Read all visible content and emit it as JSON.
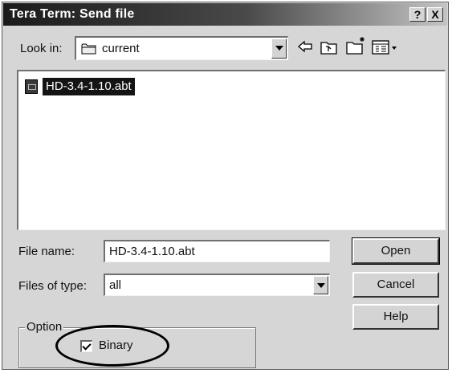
{
  "window": {
    "title": "Tera Term: Send file",
    "help_button": "?",
    "close_button": "X"
  },
  "look_in": {
    "label": "Look in:",
    "value": "current"
  },
  "toolbar": {
    "icons": [
      "back-arrow-icon",
      "up-one-level-icon",
      "new-folder-icon",
      "view-menu-icon"
    ]
  },
  "files": [
    {
      "name": "HD-3.4-1.10.abt",
      "selected": true
    }
  ],
  "file_name": {
    "label": "File name:",
    "value": "HD-3.4-1.10.abt"
  },
  "files_of_type": {
    "label": "Files of type:",
    "value": "all"
  },
  "buttons": {
    "open": "Open",
    "cancel": "Cancel",
    "help": "Help"
  },
  "option": {
    "legend": "Option",
    "binary_label": "Binary",
    "binary_checked": true
  }
}
